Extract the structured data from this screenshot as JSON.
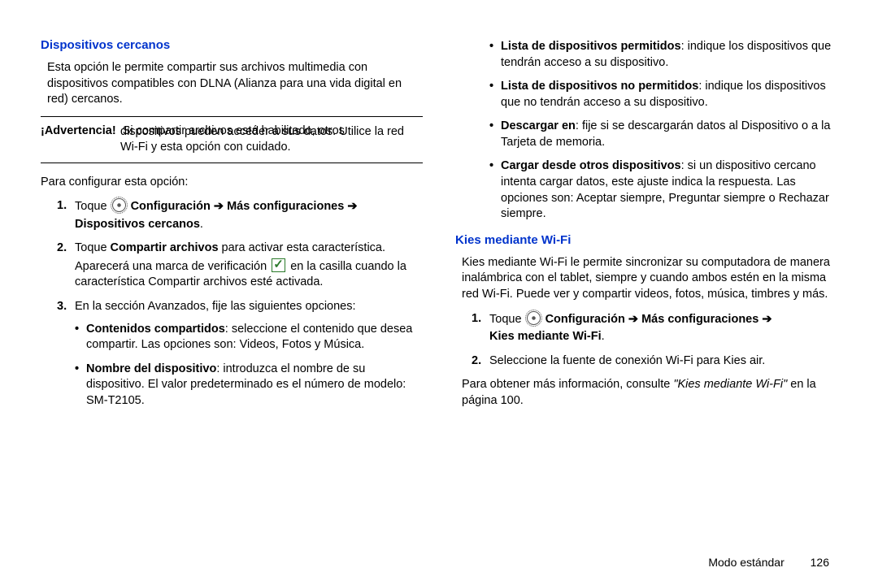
{
  "left": {
    "heading": "Dispositivos cercanos",
    "intro": "Esta opción le permite compartir sus archivos multimedia con dispositivos compatibles con DLNA (Alianza para una vida digital en red) cercanos.",
    "warning_label": "¡Advertencia!",
    "warning_first": "Si compartir archivos está habilitado, otros",
    "warning_rest": "dispositivos pueden acceder a sus datos. Utilice la red Wi-Fi y esta opción con cuidado.",
    "configure": "Para configurar esta opción:",
    "step1_pre": "Toque ",
    "step1_boldA": "Configuración",
    "arrow": " ➔ ",
    "step1_boldB": "Más configuraciones",
    "step1_boldC": "Dispositivos cercanos",
    "step2_a": "Toque ",
    "step2_bold": "Compartir archivos",
    "step2_b": " para activar esta característica.",
    "step2_line2a": "Aparecerá una marca de verificación ",
    "step2_line2b": " en la casilla cuando la característica Compartir archivos esté activada.",
    "step3": "En la sección Avanzados, fije las siguientes opciones:",
    "b1_bold": "Contenidos compartidos",
    "b1_rest": ": seleccione el contenido que desea compartir. Las opciones son: Videos, Fotos y Música.",
    "b2_bold": "Nombre del dispositivo",
    "b2_rest": ": introduzca el nombre de su dispositivo. El valor predeterminado es el número de modelo: SM-T2105."
  },
  "right": {
    "c1_bold": "Lista de dispositivos permitidos",
    "c1_rest": ": indique los dispositivos que tendrán acceso a su dispositivo.",
    "c2_bold": "Lista de dispositivos no permitidos",
    "c2_rest": ": indique los dispositivos que no tendrán acceso a su dispositivo.",
    "c3_bold": "Descargar en",
    "c3_rest": ": fije si se descargarán datos al Dispositivo o a la Tarjeta de memoria.",
    "c4_bold": "Cargar desde otros dispositivos",
    "c4_rest": ": si un dispositivo cercano intenta cargar datos, este ajuste indica la respuesta. Las opciones son: Aceptar siempre, Preguntar siempre o Rechazar siempre.",
    "heading2": "Kies mediante Wi-Fi",
    "intro2": "Kies mediante Wi-Fi le permite sincronizar su computadora de manera inalámbrica con el tablet, siempre y cuando ambos estén en la misma red Wi-Fi. Puede ver y compartir videos, fotos, música, timbres y más.",
    "s1_pre": "Toque ",
    "s1_boldA": "Configuración",
    "s1_boldB": "Más configuraciones",
    "s1_boldC": "Kies mediante Wi-Fi",
    "s2": "Seleccione la fuente de conexión Wi-Fi para Kies air.",
    "more_a": "Para obtener más información, consulte ",
    "more_italic": "\"Kies mediante Wi-Fi\"",
    "more_b": " en la página 100."
  },
  "footer": {
    "section": "Modo estándar",
    "page": "126"
  }
}
